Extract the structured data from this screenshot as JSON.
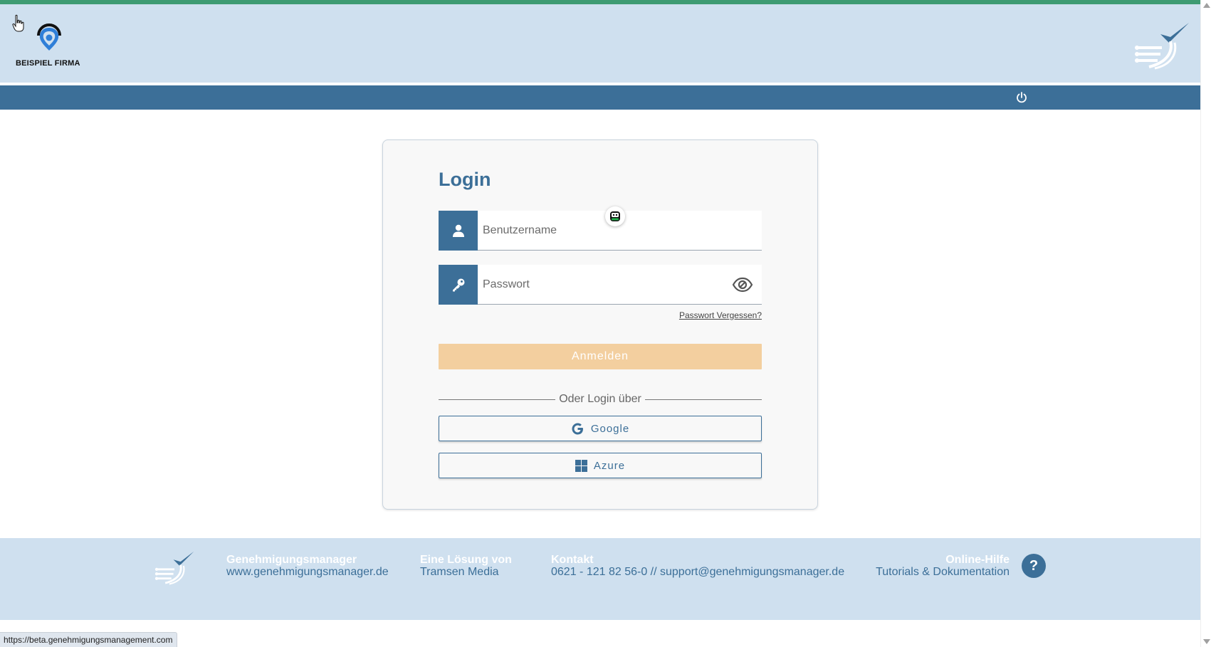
{
  "header": {
    "company_name": "BEISPIEL FIRMA",
    "brand_color": "#3c6f98",
    "accent_color": "#3e9b72",
    "header_bg": "#cfe0ef"
  },
  "navbar": {
    "logout_icon": "power-icon"
  },
  "login": {
    "title": "Login",
    "username_placeholder": "Benutzername",
    "password_placeholder": "Passwort",
    "forgot_password": "Passwort Vergessen?",
    "submit_label": "Anmelden",
    "submit_color": "#f3cf9f",
    "divider_text": "Oder Login über",
    "sso": [
      {
        "label": "Google",
        "icon": "google-icon"
      },
      {
        "label": "Azure",
        "icon": "windows-icon"
      }
    ]
  },
  "footer": {
    "gm_title": "Genehmigungsmanager",
    "gm_url": "www.genehmigungsmanager.de",
    "solution_title": "Eine Lösung von",
    "solution_by": "Tramsen Media",
    "contact_title": "Kontakt",
    "contact_info": "0621 - 121 82 56-0 // support@genehmigungsmanager.de",
    "help_title": "Online-Hilfe",
    "help_sub": "Tutorials & Dokumentation",
    "help_symbol": "?"
  },
  "status_bar": {
    "url": "https://beta.genehmigungsmanagement.com"
  }
}
